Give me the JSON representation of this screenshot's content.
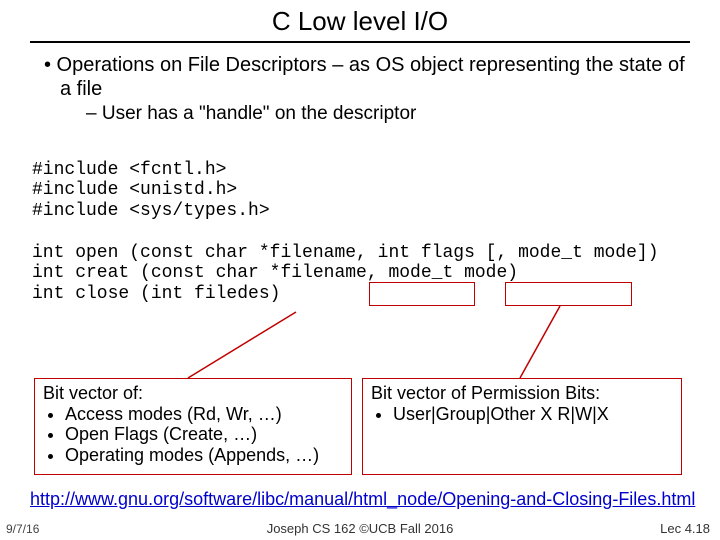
{
  "title": "C Low level I/O",
  "bullets": {
    "b1": "• Operations on File Descriptors – as OS object representing the state of a file",
    "b2": "– User has a \"handle\" on the descriptor"
  },
  "code": {
    "l1": "#include <fcntl.h>",
    "l2": "#include <unistd.h>",
    "l3": "#include <sys/types.h>",
    "l4": "",
    "l5": "int open (const char *filename, int flags [, mode_t mode])",
    "l6": "int creat (const char *filename, mode_t mode)",
    "l7": "int close (int filedes)"
  },
  "box1": {
    "header": "Bit vector of:",
    "i1": "Access modes (Rd, Wr, …)",
    "i2": "Open Flags (Create, …)",
    "i3": "Operating modes (Appends, …)"
  },
  "box2": {
    "header": "Bit vector of Permission Bits:",
    "i1": "User|Group|Other X R|W|X"
  },
  "link": "http://www.gnu.org/software/libc/manual/html_node/Opening-and-Closing-Files.html",
  "footer": {
    "left": "9/7/16",
    "center": "Joseph CS 162 ©UCB Fall 2016",
    "right": "Lec 4.18"
  }
}
